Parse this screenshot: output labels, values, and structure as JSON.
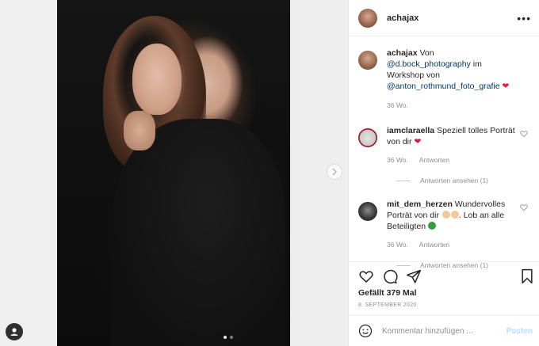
{
  "post": {
    "username": "achajax",
    "more_icon": "more-horizontal-icon",
    "photo_alt": "portrait of a woman in a black sweater",
    "carousel": {
      "count": 2,
      "active": 0
    }
  },
  "caption": {
    "username": "achajax",
    "text_1": "Von",
    "mention_1": "@d.bock_photography",
    "text_2": "im Workshop von",
    "mention_2": "@anton_rothmund_foto_grafie",
    "age": "36 Wo."
  },
  "comments": [
    {
      "username": "iamclaraella",
      "text": "Speziell tolles Porträt von dir",
      "age": "36 Wo.",
      "reply_label": "Antworten",
      "view_replies": "Antworten ansehen (1)"
    },
    {
      "username": "mit_dem_herzen",
      "text_1": "Wundervolles Porträt von dir",
      "text_2": ". Lob an alle Beteiligten",
      "age": "36 Wo.",
      "reply_label": "Antworten",
      "view_replies": "Antworten ansehen (1)"
    }
  ],
  "actions": {
    "likes": "Gefällt 379 Mal",
    "date": "8. SEPTEMBER 2020"
  },
  "add_comment": {
    "placeholder": "Kommentar hinzufügen ...",
    "post_label": "Posten"
  },
  "colors": {
    "link": "#00376b",
    "post_disabled": "#b2dffc",
    "heart": "#ed1c3c"
  }
}
